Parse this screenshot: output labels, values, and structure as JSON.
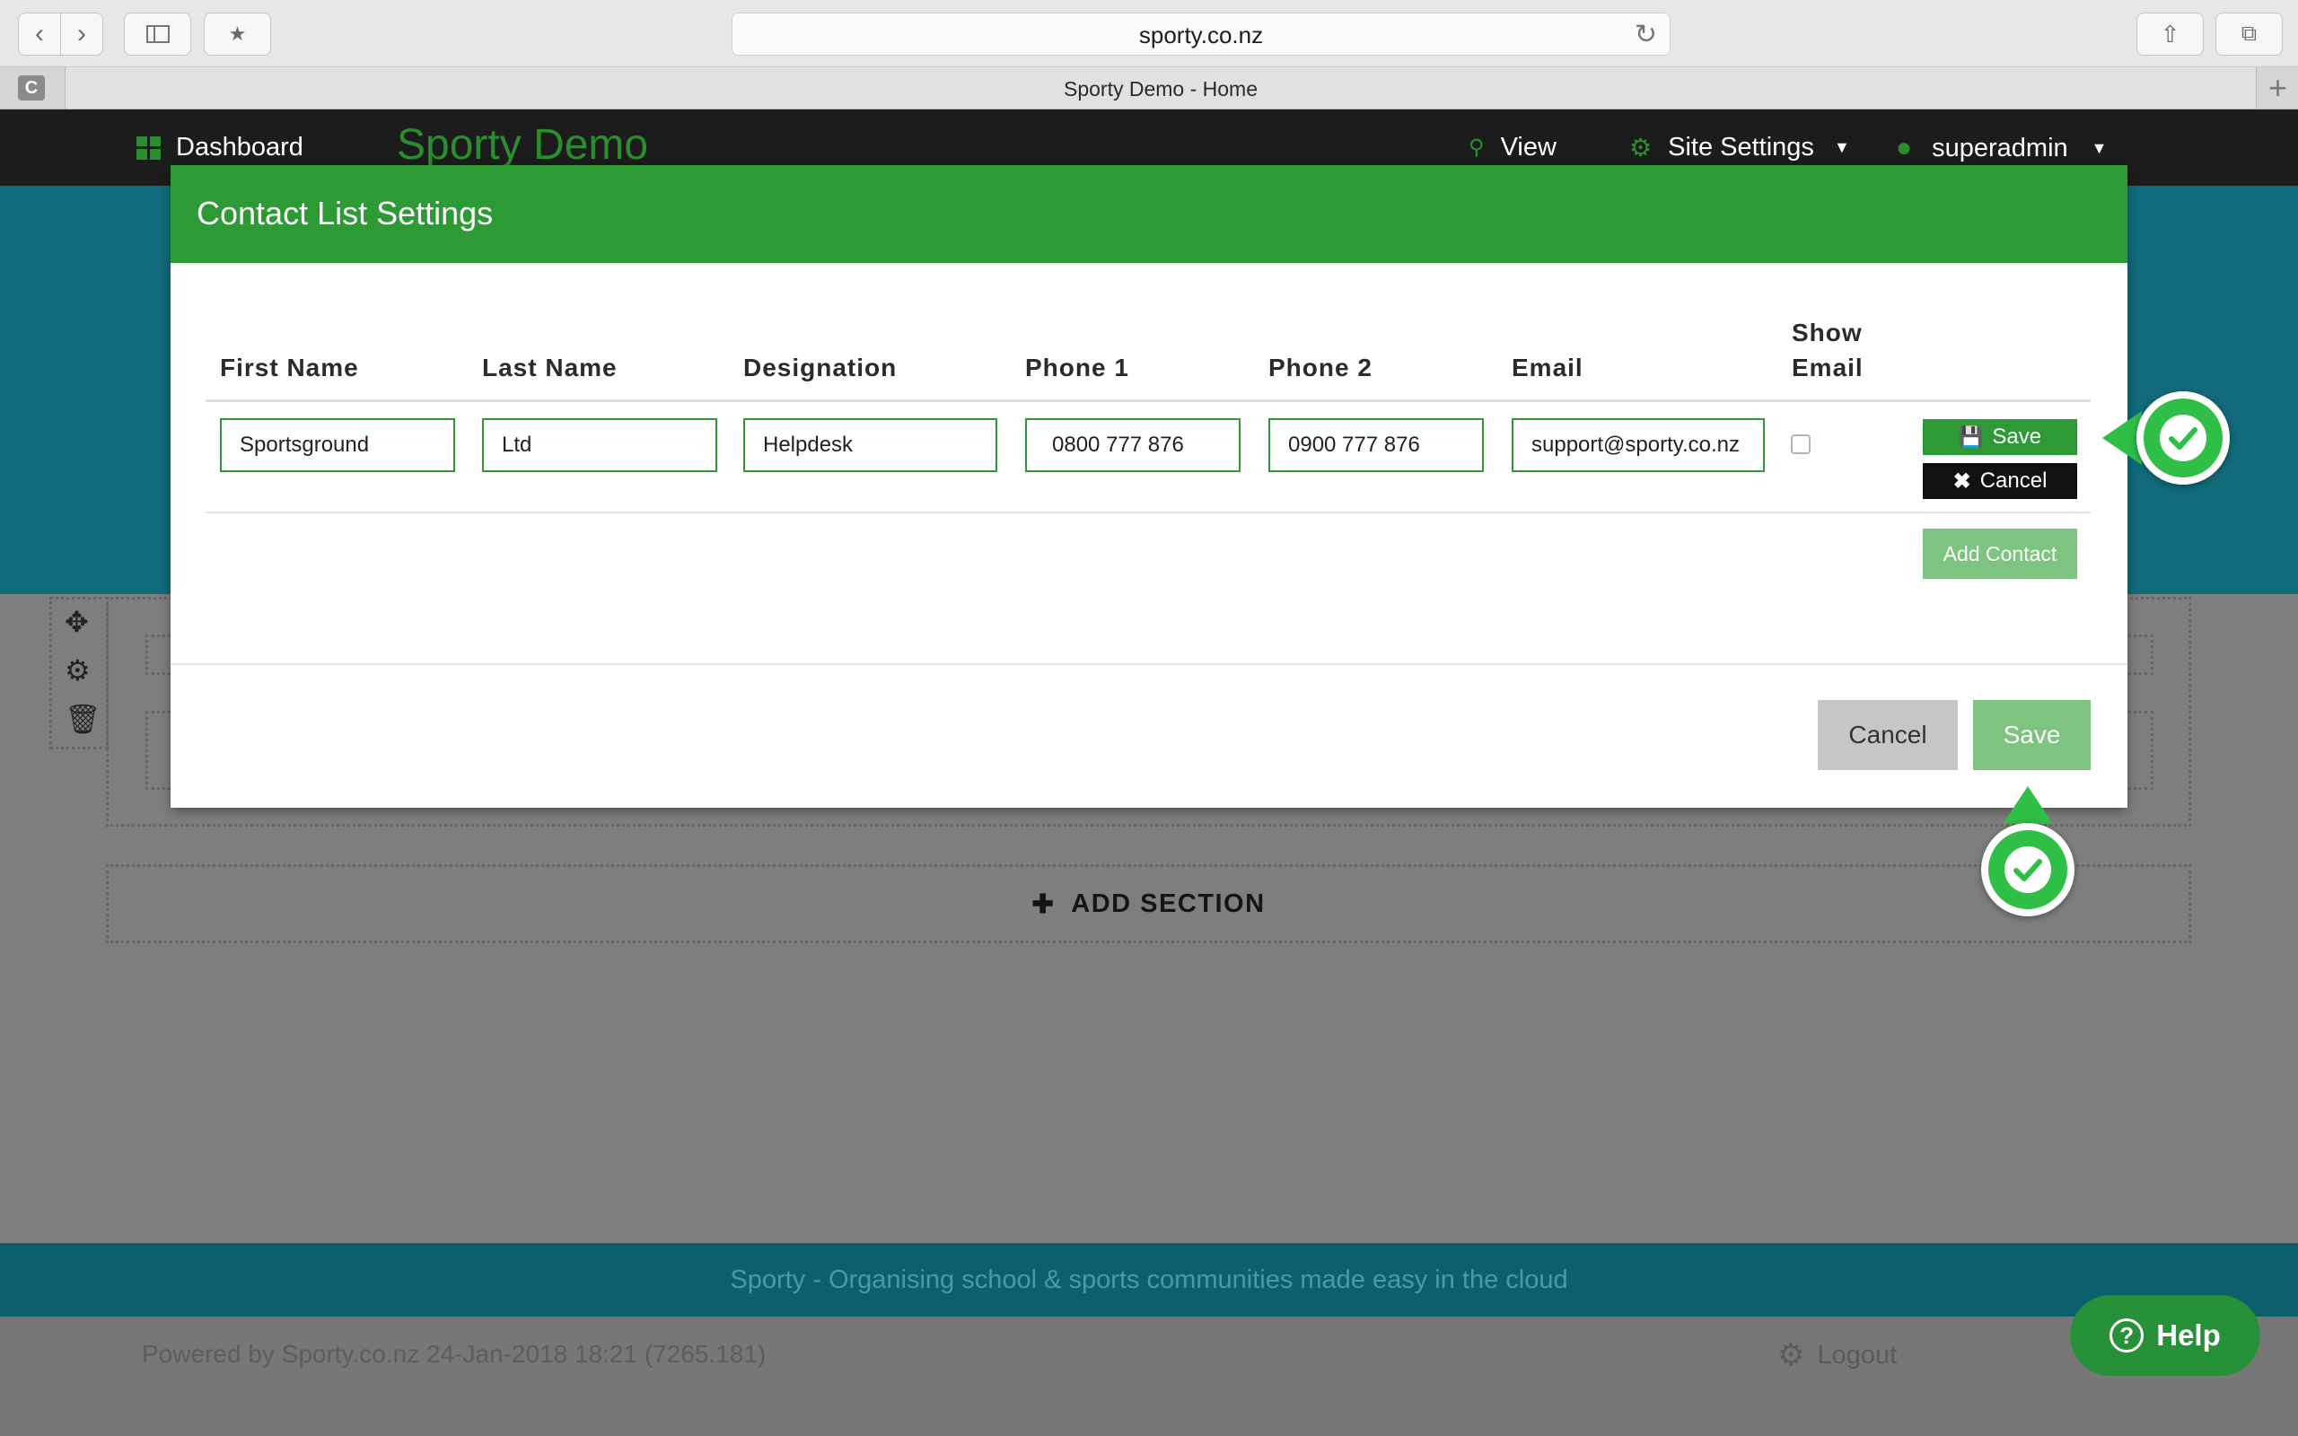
{
  "browser": {
    "url": "sporty.co.nz",
    "tab_title": "Sporty Demo - Home",
    "favicon_letter": "C"
  },
  "site_nav": {
    "dashboard_label": "Dashboard",
    "site_title": "Sporty Demo",
    "view_label": "View",
    "settings_label": "Site Settings",
    "user_label": "superadmin"
  },
  "page": {
    "add_section_label": "ADD SECTION",
    "tagline": "Sporty - Organising school & sports communities made easy in the cloud",
    "powered_by": "Powered by Sporty.co.nz 24-Jan-2018 18:21 (7265.181)",
    "logout_label": "Logout",
    "help_label": "Help"
  },
  "modal": {
    "title": "Contact List Settings",
    "columns": {
      "first_name": "First Name",
      "last_name": "Last Name",
      "designation": "Designation",
      "phone1": "Phone 1",
      "phone2": "Phone 2",
      "email": "Email",
      "show_email_line1": "Show",
      "show_email_line2": "Email"
    },
    "row": {
      "first_name": "Sportsground",
      "last_name": "Ltd",
      "designation": "Helpdesk",
      "phone1": "0800 777 876",
      "phone2": "0900 777 876",
      "email": "support@sporty.co.nz",
      "show_email": false
    },
    "row_save_label": "Save",
    "row_cancel_label": "Cancel",
    "add_contact_label": "Add Contact",
    "cancel_label": "Cancel",
    "save_label": "Save"
  },
  "colors": {
    "brand_green": "#2e9a35",
    "light_green": "#7cc47f",
    "marker_green": "#2fbf47",
    "nav_dark": "#1c1c1c",
    "teal": "#116b7a"
  }
}
